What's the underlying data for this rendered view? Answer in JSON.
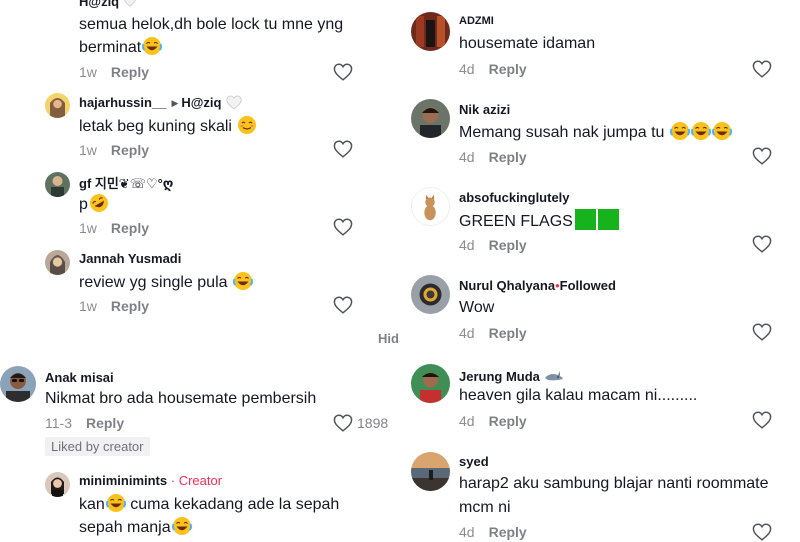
{
  "left": {
    "comments": [
      {
        "name": "H@ziq",
        "text": "semua helok,dh bole lock tu mne yng",
        "text2": "berminat",
        "time": "1w",
        "reply": "Reply"
      },
      {
        "name": "hajarhussin__",
        "reply_to": "H@ziq",
        "text": "letak beg kuning skali",
        "time": "1w",
        "reply": "Reply"
      },
      {
        "name": "gf 지민❦☏♡°ღ",
        "text": "p",
        "time": "1w",
        "reply": "Reply"
      },
      {
        "name": "Jannah Yusmadi",
        "text": "review yg single pula",
        "time": "1w",
        "reply": "Reply"
      },
      {
        "name": "Anak misai",
        "text": "Nikmat bro ada housemate pembersih",
        "time": "11-3",
        "reply": "Reply",
        "likes": "1898",
        "badge": "Liked by creator"
      },
      {
        "name": "miniminimints",
        "creator_label": "Creator",
        "text": "kan",
        "text_b": " cuma kekadang ade la sepah",
        "text2": "sepah manja",
        "time": "",
        "reply": ""
      }
    ],
    "hide_label": "Hid"
  },
  "right": {
    "comments": [
      {
        "name": "ADZMI",
        "text": "housemate idaman",
        "time": "4d",
        "reply": "Reply"
      },
      {
        "name": "Nik azizi",
        "text": "Memang susah nak jumpa tu",
        "time": "4d",
        "reply": "Reply"
      },
      {
        "name": "absofuckinglutely",
        "text": "GREEN FLAGS",
        "time": "4d",
        "reply": "Reply"
      },
      {
        "name": "Nurul Qhalyana",
        "followed": "Followed",
        "text": "Wow",
        "time": "4d",
        "reply": "Reply"
      },
      {
        "name": "Jerung Muda",
        "text": "heaven gila kalau macam ni.........",
        "time": "4d",
        "reply": "Reply"
      },
      {
        "name": "syed",
        "text": "harap2 aku sambung blajar nanti roommate",
        "text2": "mcm ni",
        "time": "4d",
        "reply": "Reply"
      }
    ]
  },
  "colors": {
    "accent": "#fe2c55",
    "text": "#161823",
    "muted": "#8a8b91",
    "flag_green": "#17b31c"
  }
}
